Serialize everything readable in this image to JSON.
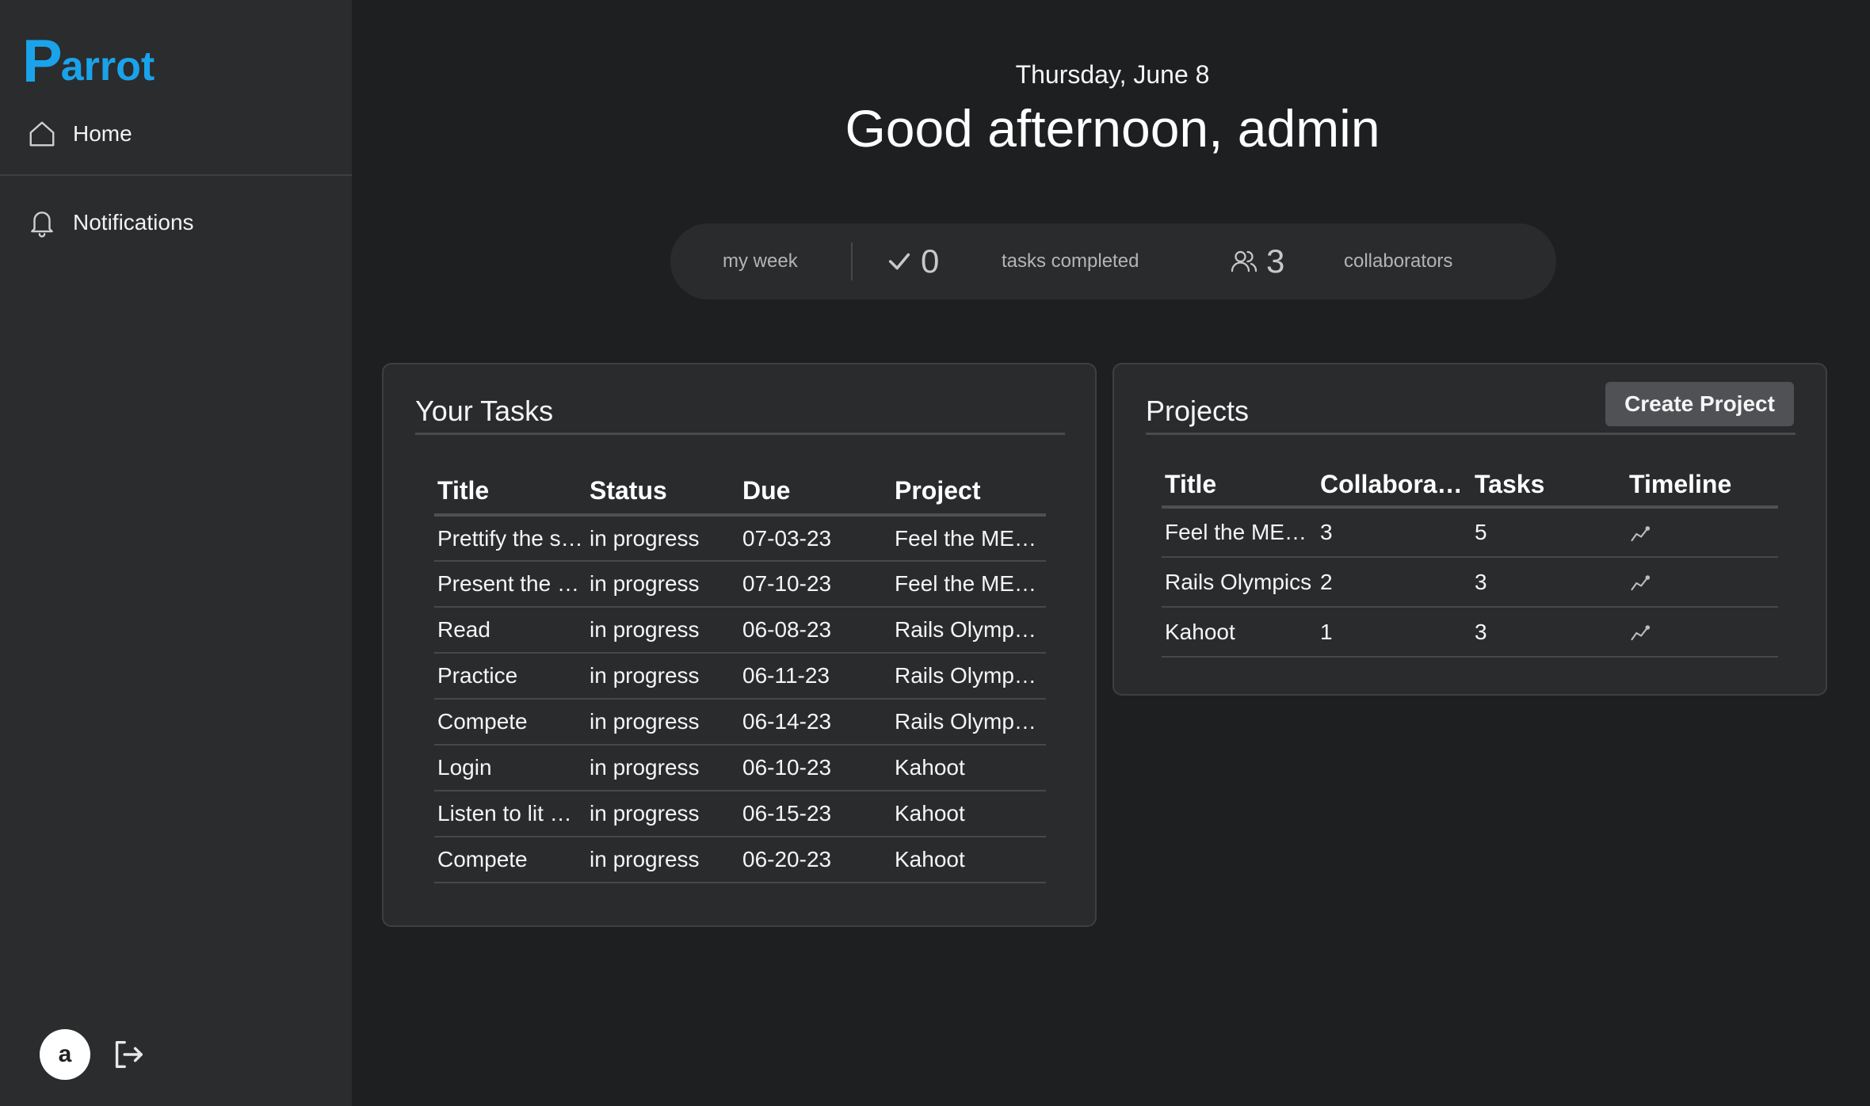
{
  "sidebar": {
    "logo_p": "P",
    "logo_rest": "arrot",
    "nav": {
      "home": "Home",
      "notifications": "Notifications"
    },
    "avatar_initial": "a"
  },
  "header": {
    "date": "Thursday, June 8",
    "greeting": "Good afternoon, admin"
  },
  "stats": {
    "period": "my week",
    "tasks_completed_count": "0",
    "tasks_completed_label": "tasks completed",
    "collaborators_count": "3",
    "collaborators_label": "collaborators"
  },
  "tasks": {
    "title": "Your Tasks",
    "columns": [
      "Title",
      "Status",
      "Due",
      "Project"
    ],
    "rows": [
      [
        "Prettify the s…",
        "in progress",
        "07-03-23",
        "Feel the ME…"
      ],
      [
        "Present the …",
        "in progress",
        "07-10-23",
        "Feel the ME…"
      ],
      [
        "Read",
        "in progress",
        "06-08-23",
        "Rails Olymp…"
      ],
      [
        "Practice",
        "in progress",
        "06-11-23",
        "Rails Olymp…"
      ],
      [
        "Compete",
        "in progress",
        "06-14-23",
        "Rails Olymp…"
      ],
      [
        "Login",
        "in progress",
        "06-10-23",
        "Kahoot"
      ],
      [
        "Listen to lit …",
        "in progress",
        "06-15-23",
        "Kahoot"
      ],
      [
        "Compete",
        "in progress",
        "06-20-23",
        "Kahoot"
      ]
    ]
  },
  "projects": {
    "title": "Projects",
    "create_label": "Create Project",
    "columns": [
      "Title",
      "Collabora…",
      "Tasks",
      "Timeline"
    ],
    "rows": [
      [
        "Feel the ME…",
        "3",
        "5"
      ],
      [
        "Rails Olympics",
        "2",
        "3"
      ],
      [
        "Kahoot",
        "1",
        "3"
      ]
    ]
  },
  "colors": {
    "brand": "#1aa3ea",
    "background": "#1e1f21",
    "sidebar": "#2b2c2e"
  }
}
